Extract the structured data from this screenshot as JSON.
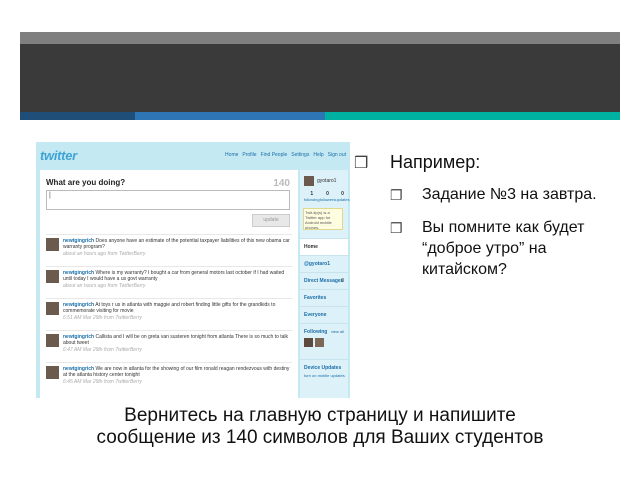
{
  "slide": {
    "bullets": [
      {
        "level": 1,
        "text": "Например:"
      },
      {
        "level": 2,
        "text": "Задание №3 на завтра."
      },
      {
        "level": 2,
        "text": "Вы помните как будет “доброе утро” на китайском?"
      }
    ],
    "caption_line1": "Вернитесь на главную страницу и напишите",
    "caption_line2": "сообщение из 140 символов для Ваших студентов",
    "colors": {
      "header": "#3a3a3a",
      "accent1": "#1f4e79",
      "accent2": "#2e75b6",
      "accent3": "#00b0a0"
    }
  },
  "twitter": {
    "logo": "twitter",
    "nav": [
      "Home",
      "Profile",
      "Find People",
      "Settings",
      "Help",
      "Sign out"
    ],
    "prompt": "What are you doing?",
    "counter": "140",
    "input_value": "|",
    "update_button": "update",
    "tweets": [
      {
        "user": "newtgingrich",
        "text": "Does anyone have an estimate of the potential taxpayer liabilities of this new obama car warranty program?",
        "meta": "about an hours ago from TwitterBerry"
      },
      {
        "user": "newtgingrich",
        "text": "Where is my warranty? I bought a car from general motors last october if I had waited until today I would have a us govt warranty",
        "meta": "about an hours ago from TwitterBerry"
      },
      {
        "user": "newtgingrich",
        "text": "At toys r us in atlanta with maggie and robert finding little gifts for the grandkids to commemorate visiting for movie",
        "meta": "6:51 AM Mar 29th from TwitterBerry"
      },
      {
        "user": "newtgingrich",
        "text": "Callista and I will be on greta van susteren tonight from atlanta There is so much to talk about tweet",
        "meta": "6:47 AM Mar 29th from TwitterBerry"
      },
      {
        "user": "newtgingrich",
        "text": "We are now in atlanta for the showing of our film ronald reagan rendezvous with destiny at the atlanta history center tonight",
        "meta": "6:45 AM Mar 29th from TwitterBerry"
      }
    ],
    "sidebar": {
      "username": "gyotaro1",
      "stats": [
        {
          "num": "1",
          "label": "following"
        },
        {
          "num": "0",
          "label": "followers"
        },
        {
          "num": "0",
          "label": "updates"
        }
      ],
      "tip": "Twit-tip(s) is a Twitter app for Android mobile phones.",
      "menu": {
        "home": "Home",
        "mention": "@gyotaro1",
        "direct": "Direct Messages",
        "direct_count": "0",
        "favorites": "Favorites",
        "everyone": "Everyone",
        "following": "Following",
        "view_all": "view all",
        "device": "Device Updates",
        "device_sub": "turn on mobile updates"
      }
    }
  }
}
